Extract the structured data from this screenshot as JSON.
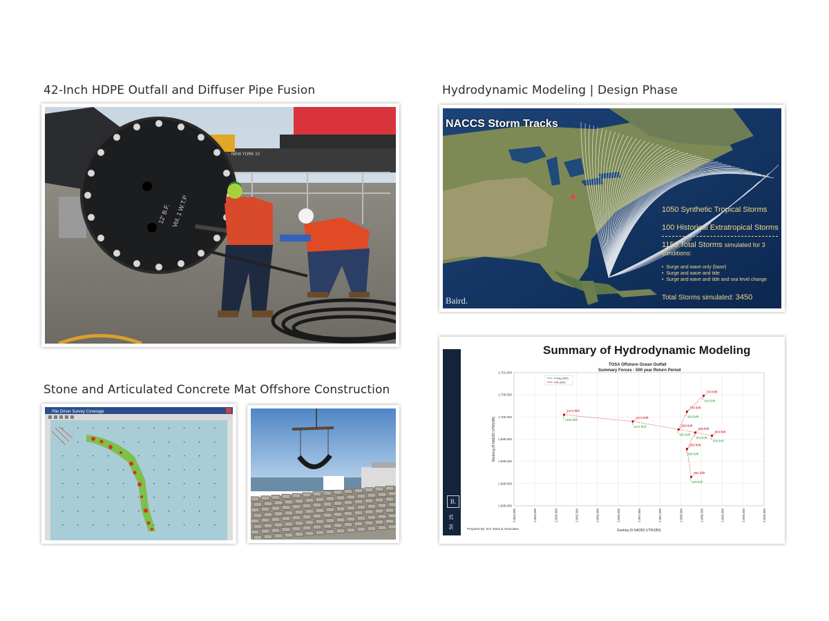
{
  "sections": {
    "fusion": {
      "title": "42-Inch HDPE Outfall and Diffuser Pipe Fusion"
    },
    "hydro": {
      "title": "Hydrodynamic Modeling | Design Phase"
    },
    "stone": {
      "title": "Stone and Articulated Concrete Mat Offshore Construction"
    }
  },
  "photo_fusion": {
    "flange_text": "12' B.F.",
    "flange_text2": "Vol. 1 W.T.P",
    "crane_text": "NEW YORK 10"
  },
  "storm_map": {
    "title": "NACCS Storm Tracks",
    "line1": "1050 Synthetic Tropical Storms",
    "line2": "100 Historical Extratropical Storms",
    "line3a": "1150 Total Storms",
    "line3b": "simulated for 3",
    "line3c": "conditions:",
    "bullets": [
      "Surge and wave only (base)",
      "Surge and wave and tide",
      "Surge and wave and tide and sea level change"
    ],
    "total_label": "Total Storms simulated:",
    "total_value": "3450",
    "logo": "Baird.",
    "colors": {
      "ocean": "#12325e",
      "track": "#ffffff",
      "text": "#f3d98a"
    }
  },
  "software": {
    "window_title": "Pile Driver Survey Coverage"
  },
  "summary": {
    "heading": "Summary of Hydrodynamic Modeling",
    "sidebar_logo": "B.",
    "sidebar_num1": "25",
    "sidebar_num2": "50",
    "prepared_by": "Prepared By: W.F. Baird & Associates",
    "chart_data": {
      "type": "scatter",
      "title": "TOSA Offshore Ocean Outfall",
      "subtitle": "Summary Forces - 500 year Return Period",
      "xlabel": "Easting (ft NAD83 UTM18N)",
      "ylabel": "Northing (ft NAD83 UTM18N)",
      "xlim": [
        2084000,
        2090000
      ],
      "ylim": [
        1698000,
        1701000
      ],
      "x_ticks": [
        "2,084,000",
        "2,084,500",
        "2,085,000",
        "2,085,500",
        "2,086,000",
        "2,086,500",
        "2,087,000",
        "2,087,500",
        "2,088,000",
        "2,088,500",
        "2,089,000",
        "2,089,500",
        "2,090,000"
      ],
      "y_ticks": [
        "1,698,000",
        "1,698,500",
        "1,699,000",
        "1,699,500",
        "1,700,000",
        "1,700,500",
        "1,701,000"
      ],
      "legend": [
        "Fdrag (lb/ft)",
        "Flift (lb/ft)"
      ],
      "grid": true,
      "points": [
        {
          "x": 2085200,
          "y": 1700050,
          "drag": "1374 lb/ft",
          "lift": "1369 lb/ft"
        },
        {
          "x": 2086850,
          "y": 1699900,
          "drag": "1274 lb/ft",
          "lift": "1137 lb/ft"
        },
        {
          "x": 2087950,
          "y": 1699720,
          "drag": "969 lb/ft",
          "lift": "960 lb/ft"
        },
        {
          "x": 2088350,
          "y": 1699650,
          "drag": "835 lb/ft",
          "lift": "974 lb/ft"
        },
        {
          "x": 2088750,
          "y": 1699580,
          "drag": "804 lb/ft",
          "lift": "936 lb/ft"
        },
        {
          "x": 2088150,
          "y": 1699280,
          "drag": "853 lb/ft",
          "lift": "849 lb/ft"
        },
        {
          "x": 2088250,
          "y": 1698650,
          "drag": "851 lb/ft",
          "lift": "949 lb/ft"
        },
        {
          "x": 2088150,
          "y": 1700120,
          "drag": "740 lb/ft",
          "lift": "863 lb/ft"
        },
        {
          "x": 2088550,
          "y": 1700480,
          "drag": "704 lb/ft",
          "lift": "816 lb/ft"
        }
      ]
    }
  }
}
